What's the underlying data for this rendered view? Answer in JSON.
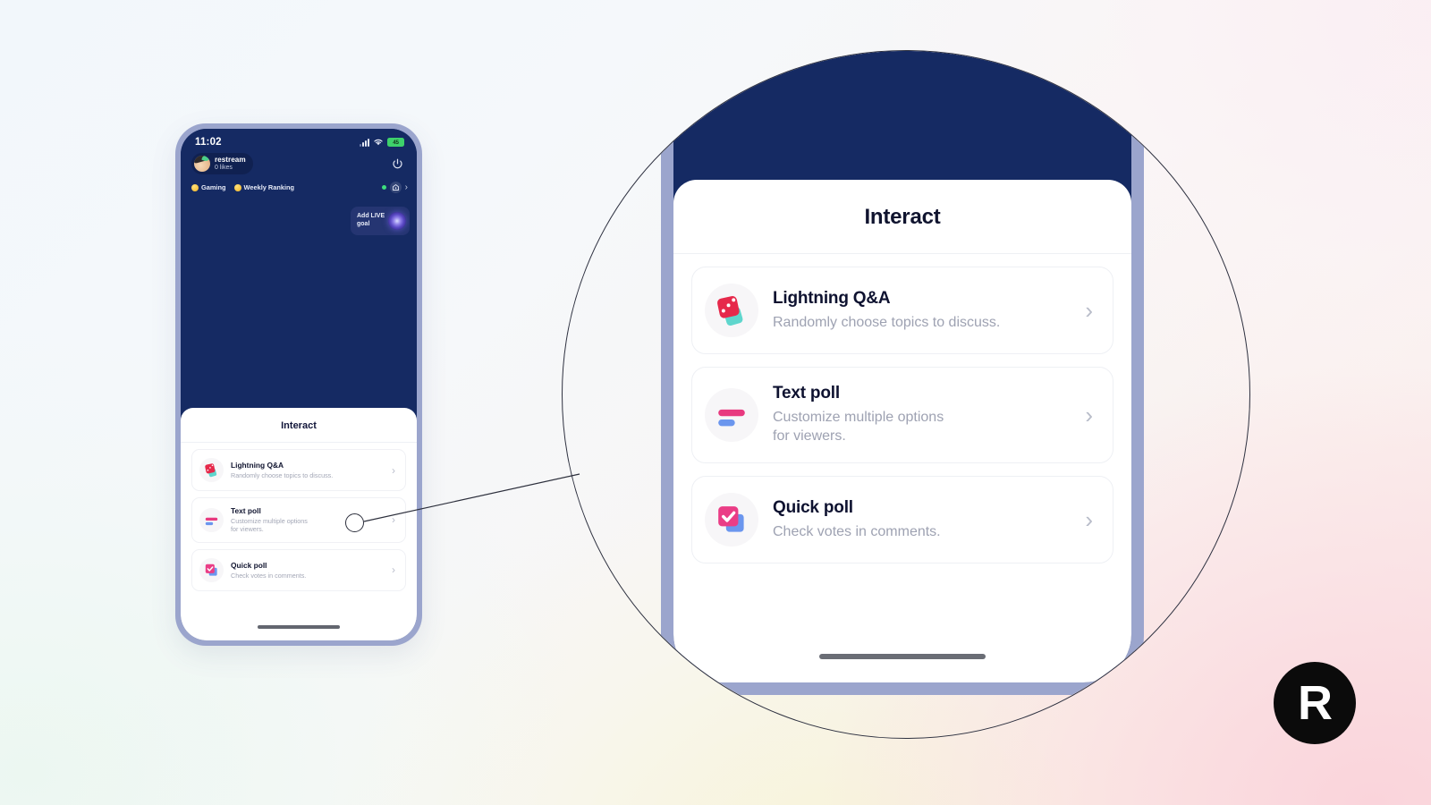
{
  "brand": {
    "logo_letter": "R",
    "logo_bg": "#0b0b0b",
    "accent_pink": "#e8397f",
    "accent_blue": "#6b96ee",
    "accent_red": "#e6294b",
    "accent_teal": "#5fd6cd",
    "phone_frame": "#9ba5cd",
    "stream_bg": "#152a63"
  },
  "phone": {
    "status_bar": {
      "time": "11:02",
      "battery_label": "45",
      "signal_icon": "cellular-signal-icon",
      "wifi_icon": "wifi-icon",
      "battery_icon": "battery-icon"
    },
    "stream_overlay": {
      "channel_name": "restream",
      "likes": "0 likes",
      "avatar_icon": "channel-avatar",
      "power_icon": "power-icon",
      "tags": [
        {
          "label": "Gaming",
          "icon": "coin-icon"
        },
        {
          "label": "Weekly Ranking",
          "icon": "coin-icon"
        }
      ],
      "live_indicator_icon": "live-dot-icon",
      "viewer_control_icon": "broadcast-icon",
      "expand_icon": "chevron-right-icon",
      "live_goal": {
        "label": "Add LIVE\ngoal",
        "line1": "Add LIVE",
        "line2": "goal",
        "icon": "target-icon"
      }
    },
    "home_indicator": "home-indicator"
  },
  "interact_sheet": {
    "title": "Interact",
    "items": [
      {
        "title": "Lightning Q&A",
        "subtitle": "Randomly choose topics to discuss.",
        "subtitle_line1": "Randomly choose topics to discuss.",
        "subtitle_line2": "",
        "icon": "dice-icon",
        "chevron": "chevron-right-icon"
      },
      {
        "title": "Text poll",
        "subtitle": "Customize multiple options for viewers.",
        "subtitle_line1": "Customize multiple options",
        "subtitle_line2": "for viewers.",
        "icon": "poll-bars-icon",
        "chevron": "chevron-right-icon"
      },
      {
        "title": "Quick poll",
        "subtitle": "Check votes in comments.",
        "subtitle_line1": "Check votes in comments.",
        "subtitle_line2": "",
        "icon": "checkbox-stack-icon",
        "chevron": "chevron-right-icon"
      }
    ]
  },
  "magnifier": {
    "focus_target": "text-poll-row",
    "callout_label": ""
  }
}
